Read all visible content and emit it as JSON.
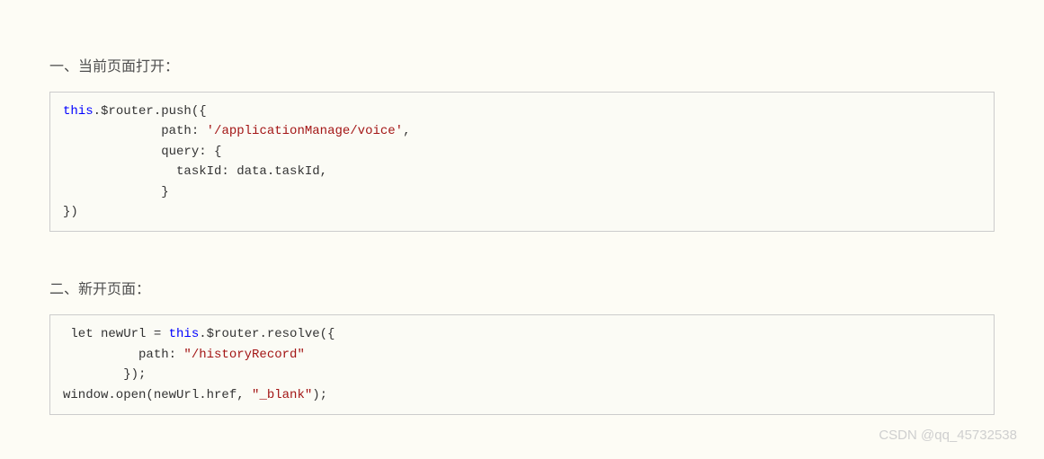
{
  "sections": [
    {
      "heading": "一、当前页面打开：",
      "code": {
        "tokens": [
          {
            "type": "keyword",
            "text": "this"
          },
          {
            "type": "plain",
            "text": ".$router.push({\n             path: "
          },
          {
            "type": "string",
            "text": "'/applicationManage/voice'"
          },
          {
            "type": "plain",
            "text": ",\n             query: {\n               taskId: data.taskId,\n             }\n})"
          }
        ]
      }
    },
    {
      "heading": "二、新开页面：",
      "code": {
        "tokens": [
          {
            "type": "plain",
            "text": " let newUrl = "
          },
          {
            "type": "keyword",
            "text": "this"
          },
          {
            "type": "plain",
            "text": ".$router.resolve({\n          path: "
          },
          {
            "type": "string",
            "text": "\"/historyRecord\""
          },
          {
            "type": "plain",
            "text": "\n        });\nwindow.open(newUrl.href, "
          },
          {
            "type": "string",
            "text": "\"_blank\""
          },
          {
            "type": "plain",
            "text": ");"
          }
        ]
      }
    }
  ],
  "watermark": "CSDN @qq_45732538"
}
